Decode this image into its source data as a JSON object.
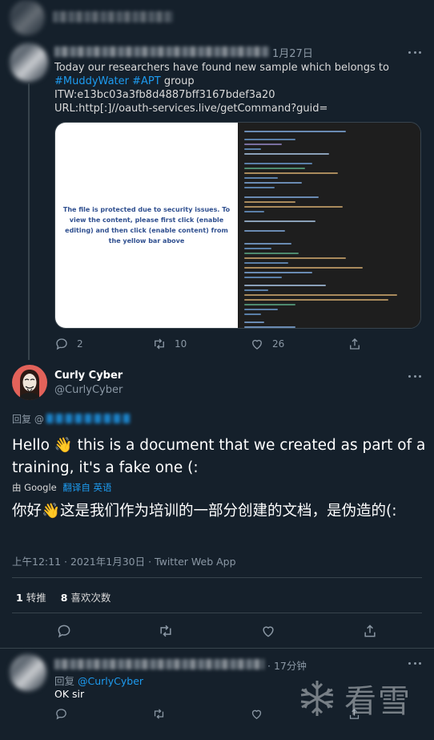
{
  "tweet1": {
    "time": "1月27日",
    "text_line1": "Today our researchers have found new sample which belongs to",
    "hashtag1": "#MuddyWater",
    "hashtag2": "#APT",
    "text_group": " group",
    "itw": "ITW:e13bc03a3fb8d4887bff3167bdef3a20",
    "url": "URL:http[:]//oauth-services.live/getCommand?guid=",
    "doc_message": "The file is protected due to security issues. To view the content, please first click (enable editing) and then click (enable content) from the yellow bar above",
    "replies": "2",
    "retweets": "10",
    "likes": "26"
  },
  "tweet2": {
    "display_name": "Curly Cyber",
    "handle": "@CurlyCyber",
    "reply_prefix": "回复 @",
    "text": "Hello 👋 this is a document that we created as part of a training, it's a fake one (:",
    "translate_by": "由 Google",
    "translate_link": "翻译自 英语",
    "translated": "你好👋这是我们作为培训的一部分创建的文档，是伪造的(:",
    "meta": "上午12:11 · 2021年1月30日 · Twitter Web App",
    "retweet_count": "1",
    "retweet_label": "转推",
    "like_count": "8",
    "like_label": "喜欢次数"
  },
  "tweet3": {
    "time": "· 17分钟",
    "reply_prefix": "回复",
    "reply_handle": "@CurlyCyber",
    "text": "OK sir"
  },
  "watermark": {
    "text": "看雪"
  },
  "colors": {
    "background": "#15202b",
    "accent": "#1d9bf0",
    "muted": "#8b98a5",
    "divider": "#38444d"
  },
  "icons": [
    "more-icon",
    "reply-icon",
    "retweet-icon",
    "like-icon",
    "share-icon",
    "snowflake-icon"
  ]
}
